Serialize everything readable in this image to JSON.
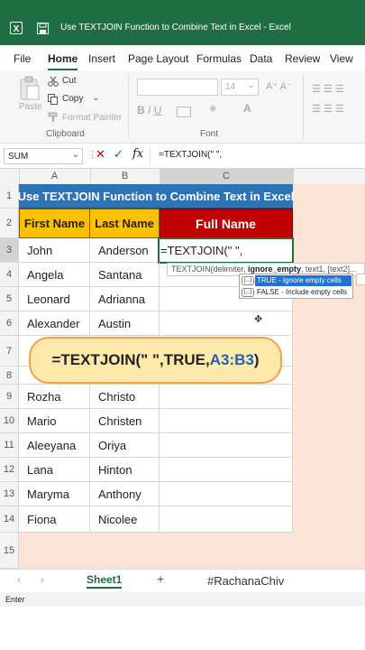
{
  "window": {
    "title": "Use TEXTJOIN Function to Combine Text in Excel  -  Excel"
  },
  "menu": [
    "File",
    "Home",
    "Insert",
    "Page Layout",
    "Formulas",
    "Data",
    "Review",
    "View"
  ],
  "ribbon": {
    "paste": "Paste",
    "cut": "Cut",
    "copy": "Copy",
    "format_painter": "Format Painter",
    "clipboard_group": "Clipboard",
    "font_size": "14",
    "font_group": "Font"
  },
  "formula_bar": {
    "name_box": "SUM",
    "fx": "fx",
    "formula": "=TEXTJOIN(\" \","
  },
  "columns": [
    "A",
    "B",
    "C"
  ],
  "rows": [
    "1",
    "2",
    "3",
    "4",
    "5",
    "6",
    "7",
    "8",
    "9",
    "10",
    "11",
    "12",
    "13",
    "14",
    "15"
  ],
  "sheet": {
    "title": "Use TEXTJOIN Function to Combine Text in Excel",
    "headers": {
      "first": "First Name",
      "last": "Last Name",
      "full": "Full Name"
    },
    "active_cell": "=TEXTJOIN(\" \",",
    "people_top": [
      {
        "first": "John",
        "last": "Anderson"
      },
      {
        "first": "Angela",
        "last": "Santana"
      },
      {
        "first": "Leonard",
        "last": "Adrianna"
      },
      {
        "first": "Alexander",
        "last": "Austin"
      }
    ],
    "people_bottom": [
      {
        "first": "Rozha",
        "last": "Christo"
      },
      {
        "first": "Mario",
        "last": "Christen"
      },
      {
        "first": "Aleeyana",
        "last": "Oriya"
      },
      {
        "first": "Lana",
        "last": "Hinton"
      },
      {
        "first": "Maryma",
        "last": "Anthony"
      },
      {
        "first": "Fiona",
        "last": "Nicolee"
      }
    ]
  },
  "tooltip": {
    "pre": "TEXTJOIN(delimiter, ",
    "bold": "ignore_empty",
    "post": ", text1, [text2]..."
  },
  "autocomplete": [
    {
      "icon": "(...)",
      "label": "TRUE - Ignore empty cells"
    },
    {
      "icon": "(...)",
      "label": "FALSE - Include empty cells"
    }
  ],
  "callout": {
    "part1": "=TEXTJOIN(\" \",TRUE,",
    "part2": "A3:B3",
    "part3": ")"
  },
  "sheet_tab": "Sheet1",
  "add_sheet": "+",
  "watermark": "#RachanaChiv",
  "status": "Enter",
  "colors": {
    "excel_green": "#1f6e43",
    "title_blue": "#2e74b5",
    "header_yellow": "#fec000",
    "header_red": "#c00000",
    "callout_fill": "#fde9a9",
    "callout_border": "#f3a04f",
    "pink": "#fbe3d6"
  }
}
